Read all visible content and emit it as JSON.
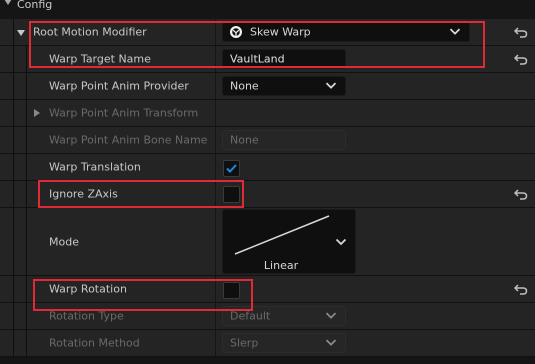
{
  "section": {
    "title": "Config"
  },
  "rows": {
    "root_motion_modifier": {
      "label": "Root Motion Modifier",
      "value": "Skew Warp"
    },
    "warp_target_name": {
      "label": "Warp Target Name",
      "value": "VaultLand"
    },
    "warp_point_anim_provider": {
      "label": "Warp Point Anim Provider",
      "value": "None"
    },
    "warp_point_anim_transform": {
      "label": "Warp Point Anim Transform"
    },
    "warp_point_anim_bone_name": {
      "label": "Warp Point Anim Bone Name",
      "value": "None"
    },
    "warp_translation": {
      "label": "Warp Translation",
      "checked": true
    },
    "ignore_zaxis": {
      "label": "Ignore ZAxis",
      "checked": false
    },
    "mode": {
      "label": "Mode",
      "value": "Linear"
    },
    "warp_rotation": {
      "label": "Warp Rotation",
      "checked": false
    },
    "rotation_type": {
      "label": "Rotation Type",
      "value": "Default"
    },
    "rotation_method": {
      "label": "Rotation Method",
      "value": "Slerp"
    }
  },
  "colors": {
    "accent_check": "#1e88e5",
    "highlight_box": "#e02b36",
    "row_bg": "#242424",
    "input_bg": "#0f0f0f"
  },
  "icons": {
    "collapse": "triangle-down-icon",
    "expand": "triangle-right-icon",
    "reset": "reset-arrow-icon",
    "dropdown": "chevron-down-icon",
    "class": "class-picker-icon",
    "check": "checkmark-icon"
  }
}
